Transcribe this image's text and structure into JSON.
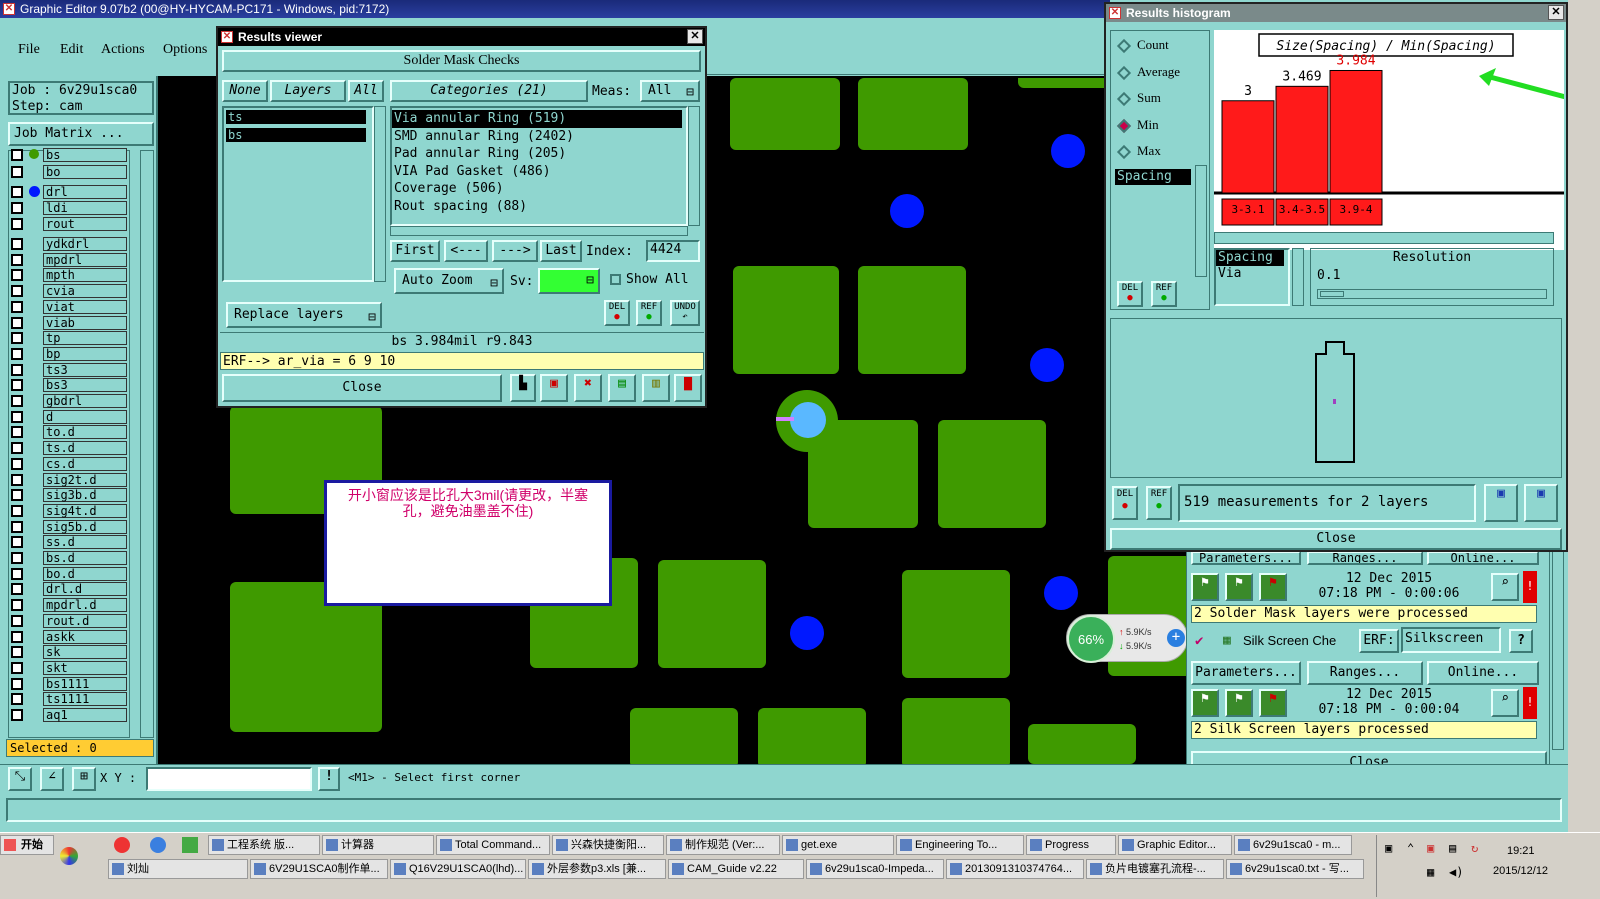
{
  "app": {
    "title": "Graphic Editor 9.07b2 (00@HY-HYCAM-PC171 - Windows, pid:7172)",
    "menu": [
      "File",
      "Edit",
      "Actions",
      "Options"
    ],
    "job_label": "Job : 6v29u1sca0",
    "step_label": "Step: cam",
    "job_matrix_btn": "Job Matrix ...",
    "selected": "Selected : 0",
    "xy_label": "X Y :",
    "status_hint": "<M1> - Select first corner"
  },
  "layers": {
    "top": [
      "bs",
      "bo"
    ],
    "group2": [
      "drl",
      "ldi",
      "rout"
    ],
    "list": [
      "ydkdrl",
      "mpdrl",
      "mpth",
      "cvia",
      "viat",
      "viab",
      "tp",
      "bp",
      "ts3",
      "bs3",
      "gbdrl",
      "d",
      "to.d",
      "ts.d",
      "cs.d",
      "sig2t.d",
      "sig3b.d",
      "sig4t.d",
      "sig5b.d",
      "ss.d",
      "bs.d",
      "bo.d",
      "drl.d",
      "mpdrl.d",
      "rout.d",
      "askk",
      "sk",
      "skt",
      "bs1111",
      "ts1111",
      "aq1"
    ]
  },
  "results_viewer": {
    "title": "Results viewer",
    "heading": "Solder Mask Checks",
    "none_btn": "None",
    "layers_btn": "Layers",
    "all_btn": "All",
    "layer_items": [
      "ts",
      "bs"
    ],
    "categories_btn": "Categories (21)",
    "meas_label": "Meas:",
    "meas_value": "All",
    "categories": [
      "Via annular Ring (519)",
      "SMD annular Ring (2402)",
      "Pad annular Ring (205)",
      "VIA Pad Gasket (486)",
      "Coverage (506)",
      "Rout spacing (88)"
    ],
    "first_btn": "First",
    "prev_btn": "<---",
    "next_btn": "--->",
    "last_btn": "Last",
    "index_label": "Index:",
    "index_value": "4424",
    "auto_zoom": "Auto Zoom",
    "sv_label": "Sv:",
    "show_all": "Show All",
    "replace_layers": "Replace layers",
    "del": "DEL",
    "ref": "REF",
    "undo": "UNDO",
    "measure_line": "bs 3.984mil  r9.843",
    "erf_line": "ERF--> ar_via = 6 9 10",
    "close": "Close"
  },
  "annotation": {
    "text": "开小窗应该是比孔大3mil(请更改，半塞孔，避免油墨盖不住)"
  },
  "net_widget": {
    "percent": "66%",
    "up": "5.9K/s",
    "down": "5.9K/s"
  },
  "histogram": {
    "title": "Results histogram",
    "stats": [
      "Count",
      "Average",
      "Sum",
      "Min",
      "Max"
    ],
    "selected_stat": "Min",
    "chart_title": "Size(Spacing) / Min(Spacing)",
    "list_item": "Spacing",
    "del": "DEL",
    "ref": "REF",
    "spacing_label": "Spacing",
    "via_label": "Via",
    "resolution_label": "Resolution",
    "resolution_value": "0.1",
    "measurements": "519 measurements for 2 layers",
    "close": "Close"
  },
  "chart_data": {
    "type": "bar",
    "title": "Size(Spacing) / Min(Spacing)",
    "categories": [
      "3-3.1",
      "3.4-3.5",
      "3.9-4"
    ],
    "values": [
      3,
      3.469,
      3.984
    ],
    "labels": [
      "3",
      "3.469",
      "3.984"
    ],
    "ylim": [
      0,
      4.2
    ],
    "bar_color": "#ff1a1a",
    "highlight_label_color": "#e00000"
  },
  "checklist": {
    "row1_buttons": [
      "Parameters...",
      "Ranges...",
      "Online..."
    ],
    "sm_date": "12 Dec 2015",
    "sm_time": "07:18 PM - 0:00:06",
    "sm_status": "2 Solder Mask layers were processed",
    "silk_name": "Silk Screen Che",
    "erf_label": "ERF:",
    "erf_value": "Silkscreen",
    "help": "?",
    "row2_buttons": [
      "Parameters...",
      "Ranges...",
      "Online..."
    ],
    "ss_date": "12 Dec 2015",
    "ss_time": "07:18 PM - 0:00:04",
    "ss_status": "2 Silk Screen layers processed",
    "close": "Close"
  },
  "taskbar": {
    "start": "开始",
    "row1": [
      "工程系统 版...",
      "计算器",
      "Total Command...",
      "兴森快捷衡阳...",
      "制作规范 (Ver:...",
      "get.exe",
      "Engineering To...",
      "Progress",
      "Graphic Editor...",
      "6v29u1sca0 - m..."
    ],
    "row2": [
      "刘灿",
      "6V29U1SCA0制作单...",
      "Q16V29U1SCA0(lhd)...",
      "外层参数p3.xls [兼...",
      "CAM_Guide v2.22",
      "6v29u1sca0-Impeda...",
      "2013091310374764...",
      "负片电镀塞孔流程-...",
      "6v29u1sca0.txt - 写..."
    ],
    "time": "19:21",
    "date": "2015/12/12"
  }
}
